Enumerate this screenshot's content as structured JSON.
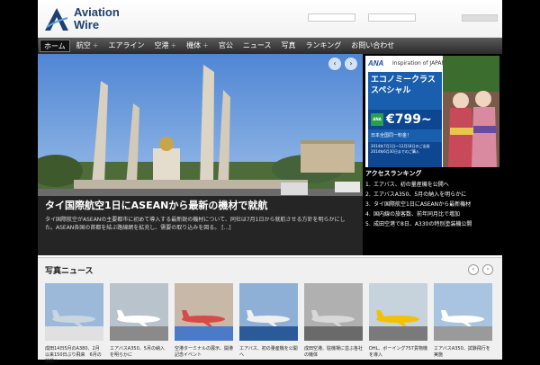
{
  "brand": {
    "line1": "Aviation",
    "line2": "Wire"
  },
  "nav": [
    {
      "label": "ホーム",
      "active": true
    },
    {
      "label": "航空",
      "plus": true
    },
    {
      "label": "エアライン"
    },
    {
      "label": "空港",
      "plus": true
    },
    {
      "label": "機体",
      "plus": true
    },
    {
      "label": "官公"
    },
    {
      "label": "ニュース"
    },
    {
      "label": "写真"
    },
    {
      "label": "ランキング"
    },
    {
      "label": "お問い合わせ"
    }
  ],
  "slide": {
    "prev": "‹",
    "next": "›",
    "title": "タイ国際航空1日にASEANから最新の機材で就航",
    "body": "タイ国際航空がASEANの主要都市に初めて導入する最新鋭の機材について、同社は7月1日から就航させる方針を明らかにした。ASEAN各国の首都を結ぶ路線網を拡充し、需要の取り込みを図る。 [...]"
  },
  "ad": {
    "brand": "ANA",
    "tagline": "Inspiration of JAPAN",
    "headline": "エコノミークラス スペシャル",
    "price": "€799~",
    "badge": "ANA",
    "note1": "日本全国同一料金！",
    "note2": "2014年7月1日～12月18日のご出発 2014年6月30日までのご購入"
  },
  "ranking": {
    "title": "アクセスランキング",
    "items": [
      {
        "n": "1.",
        "text": "エアバス、初の量産機を公開へ"
      },
      {
        "n": "2.",
        "text": "エアバスA350、5月の納入を明らかに"
      },
      {
        "n": "3.",
        "text": "タイ国際航空1日にASEANから最新機材"
      },
      {
        "n": "4.",
        "text": "国内線の旅客数、前年同月比で増加"
      },
      {
        "n": "5.",
        "text": "成田空港で8日、A330の特別塗装機公開"
      }
    ]
  },
  "photos": {
    "title": "写真ニュース",
    "prev": "‹",
    "next": "›",
    "items": [
      {
        "caption": "成田14日5月のA380、2月以来150日ぶり飛来　6月の就航へ"
      },
      {
        "caption": "エアバスA350、5月の納入を明らかに"
      },
      {
        "caption": "空港ターミナルの展示、開港記念イベント"
      },
      {
        "caption": "エアバス、初の量産機を公開へ"
      },
      {
        "caption": "成田空港、駐機場に並ぶ各社の機体"
      },
      {
        "caption": "DHL、ボーイング757貨物機を導入"
      },
      {
        "caption": "エアバスA350、試験飛行を実施"
      }
    ]
  }
}
